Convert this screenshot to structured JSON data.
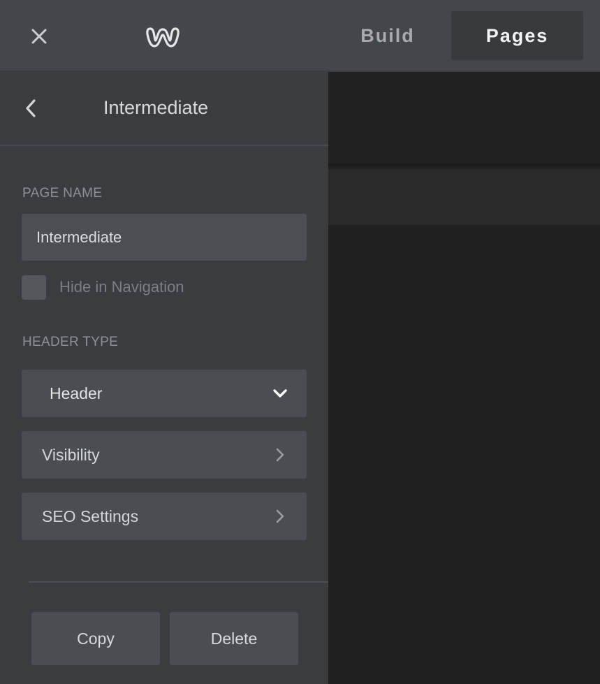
{
  "topbar": {
    "tabs": [
      {
        "label": "Build",
        "active": false
      },
      {
        "label": "Pages",
        "active": true
      }
    ]
  },
  "sidebar": {
    "title": "Intermediate",
    "page_name": {
      "label": "PAGE NAME",
      "value": "Intermediate"
    },
    "hide_in_navigation": {
      "label": "Hide in Navigation",
      "checked": false
    },
    "header_type": {
      "label": "HEADER TYPE",
      "selected": "Header"
    },
    "rows": [
      {
        "label": "Visibility"
      },
      {
        "label": "SEO Settings"
      }
    ],
    "actions": {
      "copy_label": "Copy",
      "delete_label": "Delete"
    }
  },
  "colors": {
    "topbar_bg": "#43474b",
    "sidebar_bg": "#3a3d40",
    "control_bg": "#4a4e52",
    "canvas_bg": "#202020",
    "active_tab_bg": "#373b3e"
  },
  "icons": {
    "close": "close-icon",
    "logo": "weebly-logo-icon",
    "back": "chevron-left-icon",
    "dropdown": "chevron-down-icon",
    "row_arrow": "chevron-right-icon"
  }
}
